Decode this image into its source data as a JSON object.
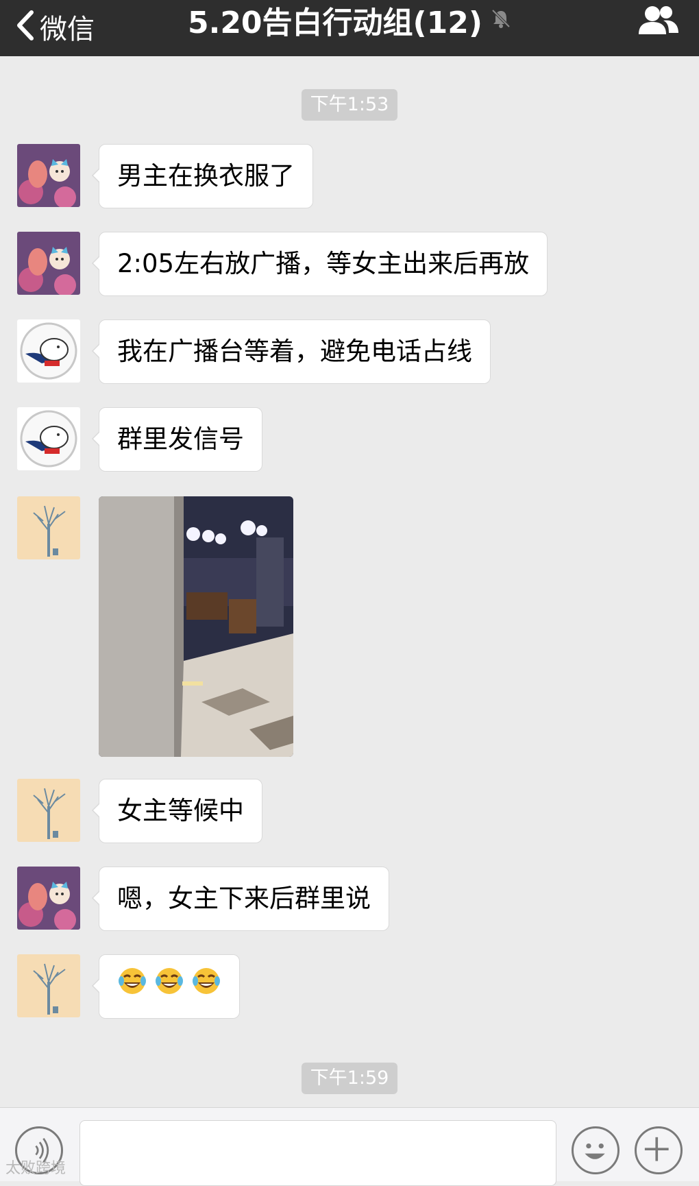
{
  "navbar": {
    "back_label": "微信",
    "title": "5.20告白行动组(12)"
  },
  "timestamps": [
    "下午1:53",
    "下午1:59"
  ],
  "messages": [
    {
      "sender": "flamingo",
      "text": "男主在换衣服了"
    },
    {
      "sender": "flamingo",
      "text": "2:05左右放广播，等女主出来后再放"
    },
    {
      "sender": "bear",
      "text": "我在广播台等着，避免电话占线"
    },
    {
      "sender": "bear",
      "text": "群里发信号"
    },
    {
      "sender": "tree",
      "type": "image"
    },
    {
      "sender": "tree",
      "text": "女主等候中"
    },
    {
      "sender": "flamingo",
      "text": "嗯，女主下来后群里说"
    },
    {
      "sender": "tree",
      "emoji": [
        "tears-of-joy",
        "tears-of-joy",
        "tears-of-joy"
      ]
    }
  ],
  "input_bar": {
    "text_value": "",
    "voice_icon": "voice-icon",
    "emoji_icon": "emoji-icon",
    "more_icon": "plus-icon"
  },
  "watermark": "太败跨境",
  "colors": {
    "navbar": "#2e2e2e",
    "background": "#ebebeb",
    "bubble": "#ffffff",
    "timestamp_bg": "#cecece"
  }
}
